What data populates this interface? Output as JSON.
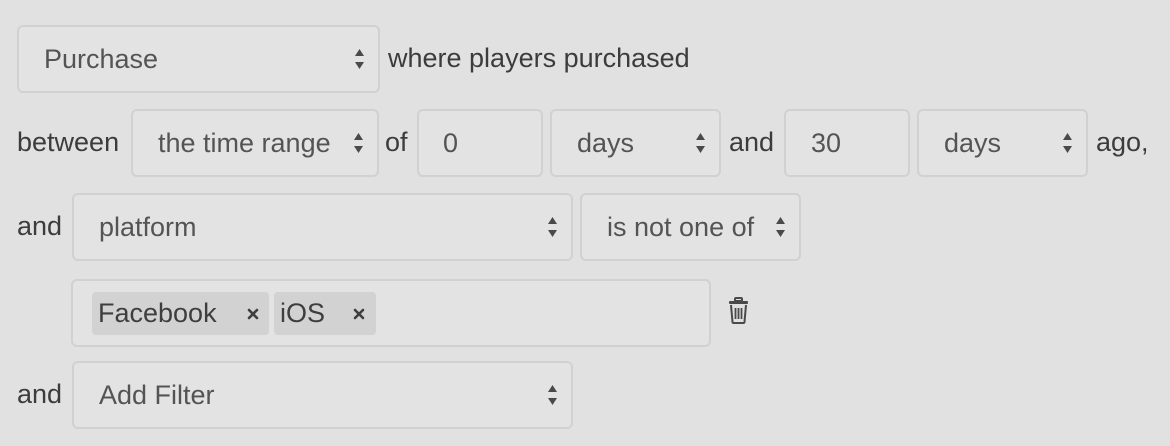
{
  "event_select": {
    "value": "Purchase"
  },
  "where_text": "where players purchased",
  "between_text": "between",
  "range_select": {
    "value": "the time range"
  },
  "of_text": "of",
  "from_input": {
    "value": "0"
  },
  "from_unit_select": {
    "value": "days"
  },
  "and_text": "and",
  "to_input": {
    "value": "30"
  },
  "to_unit_select": {
    "value": "days"
  },
  "ago_text": "ago,",
  "filter_row": {
    "prefix": "and",
    "field_select": {
      "value": "platform"
    },
    "operator_select": {
      "value": "is not one of"
    },
    "tags": [
      {
        "label": "Facebook",
        "remove_icon": "close-icon"
      },
      {
        "label": "iOS",
        "remove_icon": "close-icon"
      }
    ],
    "delete_icon": "trash-icon"
  },
  "add_filter_row": {
    "prefix": "and",
    "select": {
      "value": "Add Filter"
    }
  },
  "colors": {
    "background": "#e1e1e1",
    "control_border": "#d1d1d1",
    "tag_background": "#d2d2d2",
    "text": "#3c3c3c"
  }
}
